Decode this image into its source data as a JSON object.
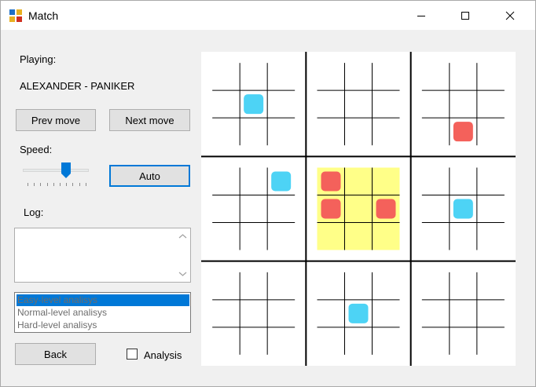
{
  "window": {
    "title": "Match",
    "icon": "app-grid-icon",
    "controls": [
      "minimize-icon",
      "maximize-icon",
      "close-icon"
    ]
  },
  "panel": {
    "playing_label": "Playing:",
    "players": "ALEXANDER - PANIKER",
    "prev_move": "Prev move",
    "next_move": "Next move",
    "speed_label": "Speed:",
    "speed_value": 0.65,
    "auto_button": "Auto",
    "log_label": "Log:",
    "log_text": "",
    "analysis_levels": [
      "Easy-level analisys",
      "Normal-level analisys",
      "Hard-level analisys"
    ],
    "selected_level": "Easy-level analisys",
    "back_button": "Back",
    "analysis_checkbox": "Analysis",
    "analysis_checked": false
  },
  "board": {
    "type": "ultimate-tic-tac-toe",
    "highlighted_subboard": {
      "row": 1,
      "col": 1
    },
    "colors": {
      "blue": "#4dd3f5",
      "red": "#f4615b",
      "highlight": "#ffff88",
      "lines": "#000000",
      "background": "#ffffff"
    },
    "pieces": [
      {
        "subboard_row": 0,
        "subboard_col": 0,
        "row": 1,
        "col": 1,
        "color": "blue"
      },
      {
        "subboard_row": 0,
        "subboard_col": 2,
        "row": 2,
        "col": 1,
        "color": "red"
      },
      {
        "subboard_row": 1,
        "subboard_col": 0,
        "row": 0,
        "col": 2,
        "color": "blue"
      },
      {
        "subboard_row": 1,
        "subboard_col": 1,
        "row": 0,
        "col": 0,
        "color": "red"
      },
      {
        "subboard_row": 1,
        "subboard_col": 1,
        "row": 1,
        "col": 0,
        "color": "red"
      },
      {
        "subboard_row": 1,
        "subboard_col": 1,
        "row": 1,
        "col": 2,
        "color": "red"
      },
      {
        "subboard_row": 1,
        "subboard_col": 2,
        "row": 1,
        "col": 1,
        "color": "blue"
      },
      {
        "subboard_row": 2,
        "subboard_col": 1,
        "row": 1,
        "col": 1,
        "color": "blue"
      }
    ]
  }
}
